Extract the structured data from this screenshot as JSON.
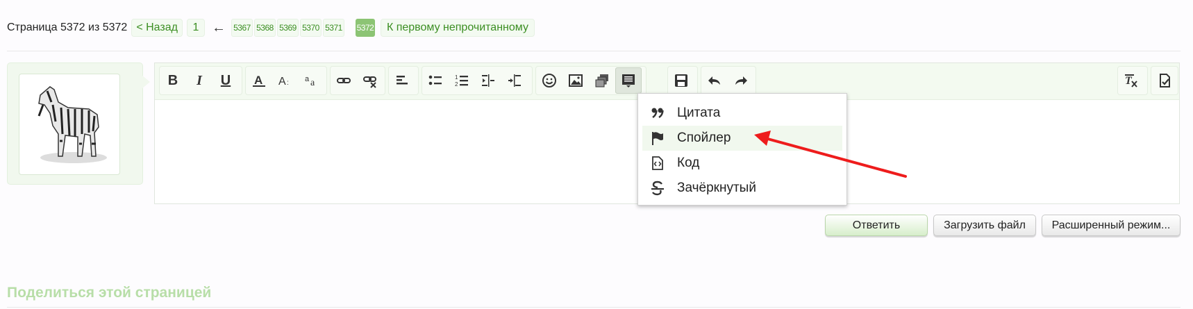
{
  "pagination": {
    "label": "Страница 5372 из 5372",
    "back": "< Назад",
    "first": "1",
    "ellipsis_arrow": "←",
    "pages": [
      "5367",
      "5368",
      "5369",
      "5370",
      "5371"
    ],
    "current": "5372",
    "first_unread": "К первому непрочитанному"
  },
  "toolbar": {
    "bold": "B",
    "italic": "I",
    "underline": "U"
  },
  "insert_menu": {
    "items": [
      {
        "label": "Цитата",
        "icon": "quote-icon"
      },
      {
        "label": "Спойлер",
        "icon": "flag-icon"
      },
      {
        "label": "Код",
        "icon": "code-file-icon"
      },
      {
        "label": "Зачёркнутый",
        "icon": "strikethrough-icon"
      }
    ],
    "hovered_index": 1
  },
  "actions": {
    "reply": "Ответить",
    "upload": "Загрузить файл",
    "advanced": "Расширенный режим..."
  },
  "share": {
    "title": "Поделиться этой страницей"
  },
  "colors": {
    "accent_green": "#3b8e22",
    "current_page_bg": "#8cc474",
    "annotation_arrow": "#ee1c1c"
  }
}
